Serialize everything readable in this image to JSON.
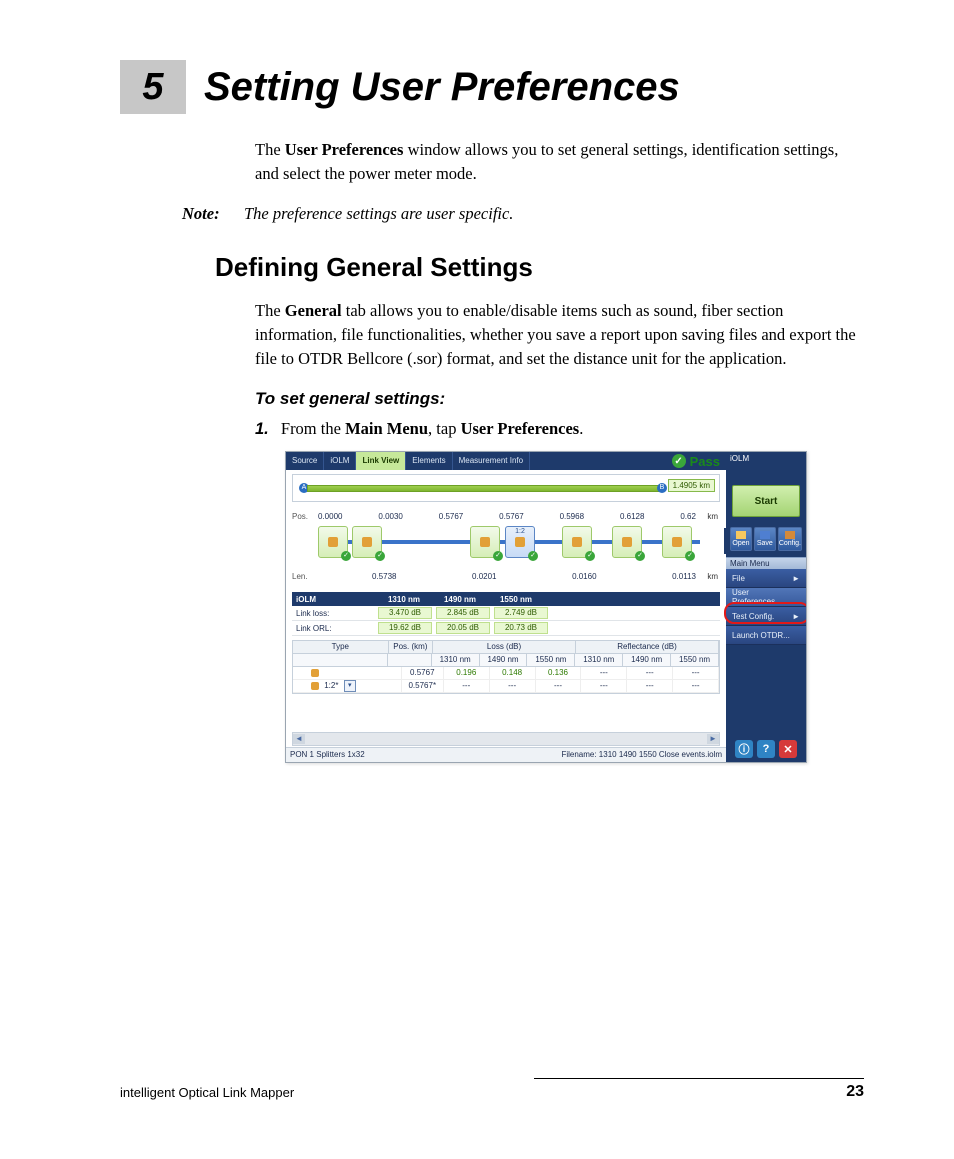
{
  "chapter": {
    "number": "5",
    "title": "Setting User Preferences"
  },
  "intro": {
    "p1_pre": "The ",
    "p1_b": "User Preferences",
    "p1_post": " window allows you to set general settings, identification settings, and select the power meter mode."
  },
  "note": {
    "label": "Note:",
    "text": "The preference settings are user specific."
  },
  "section": {
    "title": "Defining General Settings"
  },
  "general": {
    "p_pre": "The ",
    "p_b": "General",
    "p_post": " tab allows you to enable/disable items such as sound, fiber section information, file functionalities, whether you save a report upon saving files and export the file to OTDR Bellcore (.sor) format, and set the distance unit for the application."
  },
  "proc": {
    "head": "To set general settings:",
    "step1_num": "1.",
    "step1_pre": "From the ",
    "step1_b1": "Main Menu",
    "step1_mid": ", tap ",
    "step1_b2": "User Preferences",
    "step1_post": "."
  },
  "footer": {
    "left": "intelligent Optical Link Mapper",
    "right": "23"
  },
  "shot": {
    "tabs": [
      "Source",
      "iOLM",
      "Link View",
      "Elements",
      "Measurement Info"
    ],
    "active_tab_index": 2,
    "pass_label": "Pass",
    "distance_badge": "1.4905 km",
    "side_app_label": "iOLM",
    "label_a": "A",
    "label_b": "B",
    "pos_label": "Pos.",
    "len_label": "Len.",
    "km_label": "km",
    "pos_values": [
      "0.0000",
      "0.0030",
      "0.5767",
      "0.5767",
      "0.5968",
      "0.6128",
      "0.62"
    ],
    "len_values": [
      "0.5738",
      "0.0201",
      "0.0160",
      "0.0113"
    ],
    "selected_event_ratio": "1:2",
    "iolm_title": "iOLM",
    "wavelengths": [
      "1310 nm",
      "1490 nm",
      "1550 nm"
    ],
    "link_loss": {
      "label": "Link loss:",
      "vals": [
        "3.470 dB",
        "2.845 dB",
        "2.749 dB"
      ]
    },
    "link_orl": {
      "label": "Link ORL:",
      "vals": [
        "19.62 dB",
        "20.05 dB",
        "20.73 dB"
      ]
    },
    "table": {
      "h_type": "Type",
      "h_pos": "Pos. (km)",
      "h_loss": "Loss (dB)",
      "h_ref": "Reflectance (dB)",
      "sub": [
        "1310 nm",
        "1490 nm",
        "1550 nm",
        "1310 nm",
        "1490 nm",
        "1550 nm"
      ],
      "rows": [
        {
          "type_label": "",
          "pos": "0.5767",
          "loss": [
            "0.196",
            "0.148",
            "0.136"
          ],
          "ref": [
            "---",
            "---",
            "---"
          ]
        },
        {
          "type_label": "1:2*",
          "pos": "0.5767*",
          "loss": [
            "---",
            "---",
            "---"
          ],
          "ref": [
            "---",
            "---",
            "---"
          ]
        }
      ]
    },
    "status_left": "PON 1 Splitters 1x32",
    "status_right": "Filename: 1310 1490 1550 Close events.iolm",
    "side": {
      "start": "Start",
      "open": "Open",
      "save": "Save",
      "config": "Config.",
      "menu_title": "Main Menu",
      "items": [
        "File",
        "User Preferences...",
        "Test Config.",
        "Launch OTDR..."
      ],
      "chevron": "►",
      "dropdown_glyph": "▾",
      "check": "✓",
      "info": "ⓘ",
      "help": "?",
      "close": "✕",
      "scroll_left": "◄",
      "scroll_right": "►",
      "scroll_next": "▶"
    }
  }
}
